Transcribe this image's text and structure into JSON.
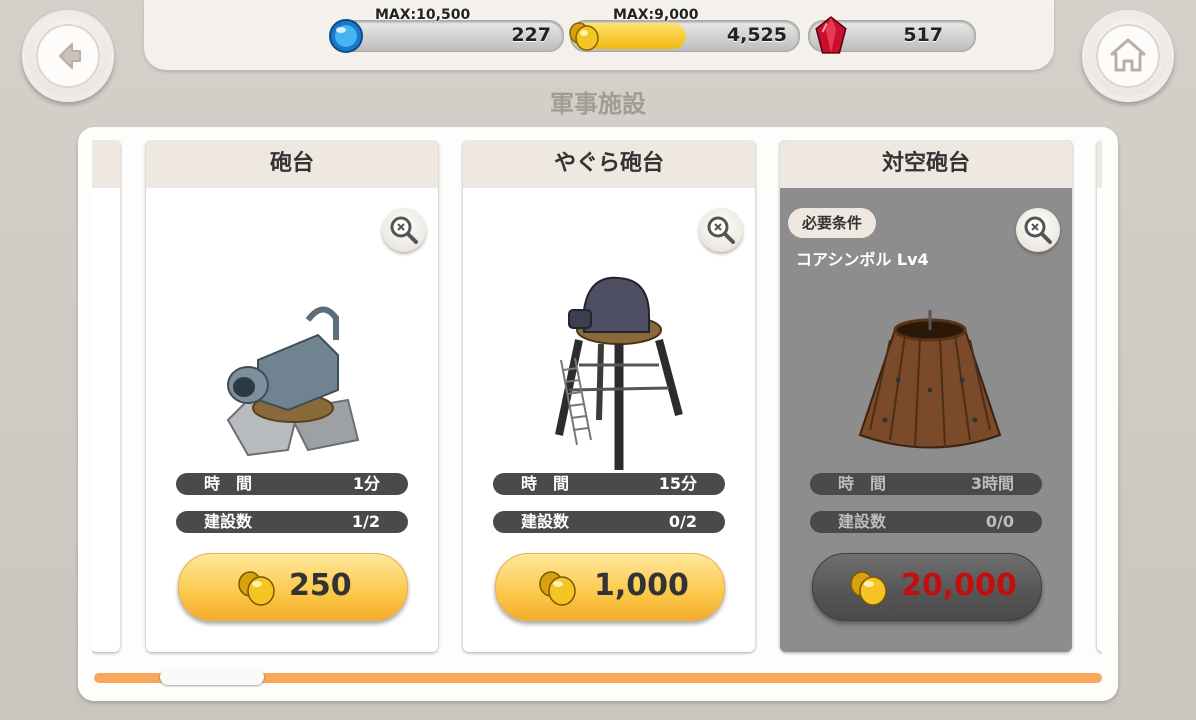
{
  "header": {
    "title": "軍事施設",
    "back_icon": "back-arrow-icon",
    "home_icon": "home-icon"
  },
  "resources": {
    "water": {
      "max_label": "MAX:10,500",
      "value": "227",
      "fill": 0.0216,
      "color": "#3aa0e8"
    },
    "gold": {
      "max_label": "MAX:9,000",
      "value": "4,525",
      "fill": 0.503,
      "color": "#f2c21c"
    },
    "gem": {
      "value": "517",
      "color": "#c8102e"
    }
  },
  "cards": [
    {
      "name": "砲台",
      "time_label": "時　間",
      "time_value": "1分",
      "count_label": "建設数",
      "count_value": "1/2",
      "price": "250",
      "locked": false
    },
    {
      "name": "やぐら砲台",
      "time_label": "時　間",
      "time_value": "15分",
      "count_label": "建設数",
      "count_value": "0/2",
      "price": "1,000",
      "locked": false
    },
    {
      "name": "対空砲台",
      "time_label": "時　間",
      "time_value": "3時間",
      "count_label": "建設数",
      "count_value": "0/0",
      "price": "20,000",
      "locked": true,
      "requirement_badge": "必要条件",
      "requirement_text": "コアシンボル Lv4"
    }
  ],
  "scroll": {
    "position": 0.07
  }
}
